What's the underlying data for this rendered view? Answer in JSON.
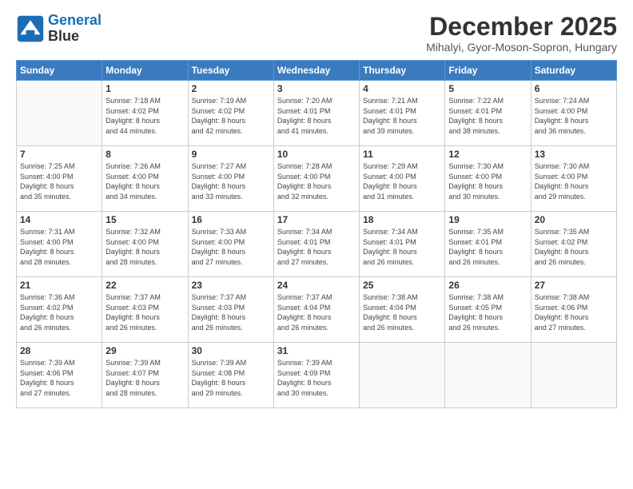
{
  "logo": {
    "line1": "General",
    "line2": "Blue"
  },
  "title": "December 2025",
  "location": "Mihalyi, Gyor-Moson-Sopron, Hungary",
  "days_of_week": [
    "Sunday",
    "Monday",
    "Tuesday",
    "Wednesday",
    "Thursday",
    "Friday",
    "Saturday"
  ],
  "weeks": [
    [
      {
        "day": "",
        "info": ""
      },
      {
        "day": "1",
        "info": "Sunrise: 7:18 AM\nSunset: 4:02 PM\nDaylight: 8 hours\nand 44 minutes."
      },
      {
        "day": "2",
        "info": "Sunrise: 7:19 AM\nSunset: 4:02 PM\nDaylight: 8 hours\nand 42 minutes."
      },
      {
        "day": "3",
        "info": "Sunrise: 7:20 AM\nSunset: 4:01 PM\nDaylight: 8 hours\nand 41 minutes."
      },
      {
        "day": "4",
        "info": "Sunrise: 7:21 AM\nSunset: 4:01 PM\nDaylight: 8 hours\nand 39 minutes."
      },
      {
        "day": "5",
        "info": "Sunrise: 7:22 AM\nSunset: 4:01 PM\nDaylight: 8 hours\nand 38 minutes."
      },
      {
        "day": "6",
        "info": "Sunrise: 7:24 AM\nSunset: 4:00 PM\nDaylight: 8 hours\nand 36 minutes."
      }
    ],
    [
      {
        "day": "7",
        "info": "Sunrise: 7:25 AM\nSunset: 4:00 PM\nDaylight: 8 hours\nand 35 minutes."
      },
      {
        "day": "8",
        "info": "Sunrise: 7:26 AM\nSunset: 4:00 PM\nDaylight: 8 hours\nand 34 minutes."
      },
      {
        "day": "9",
        "info": "Sunrise: 7:27 AM\nSunset: 4:00 PM\nDaylight: 8 hours\nand 33 minutes."
      },
      {
        "day": "10",
        "info": "Sunrise: 7:28 AM\nSunset: 4:00 PM\nDaylight: 8 hours\nand 32 minutes."
      },
      {
        "day": "11",
        "info": "Sunrise: 7:29 AM\nSunset: 4:00 PM\nDaylight: 8 hours\nand 31 minutes."
      },
      {
        "day": "12",
        "info": "Sunrise: 7:30 AM\nSunset: 4:00 PM\nDaylight: 8 hours\nand 30 minutes."
      },
      {
        "day": "13",
        "info": "Sunrise: 7:30 AM\nSunset: 4:00 PM\nDaylight: 8 hours\nand 29 minutes."
      }
    ],
    [
      {
        "day": "14",
        "info": "Sunrise: 7:31 AM\nSunset: 4:00 PM\nDaylight: 8 hours\nand 28 minutes."
      },
      {
        "day": "15",
        "info": "Sunrise: 7:32 AM\nSunset: 4:00 PM\nDaylight: 8 hours\nand 28 minutes."
      },
      {
        "day": "16",
        "info": "Sunrise: 7:33 AM\nSunset: 4:00 PM\nDaylight: 8 hours\nand 27 minutes."
      },
      {
        "day": "17",
        "info": "Sunrise: 7:34 AM\nSunset: 4:01 PM\nDaylight: 8 hours\nand 27 minutes."
      },
      {
        "day": "18",
        "info": "Sunrise: 7:34 AM\nSunset: 4:01 PM\nDaylight: 8 hours\nand 26 minutes."
      },
      {
        "day": "19",
        "info": "Sunrise: 7:35 AM\nSunset: 4:01 PM\nDaylight: 8 hours\nand 26 minutes."
      },
      {
        "day": "20",
        "info": "Sunrise: 7:35 AM\nSunset: 4:02 PM\nDaylight: 8 hours\nand 26 minutes."
      }
    ],
    [
      {
        "day": "21",
        "info": "Sunrise: 7:36 AM\nSunset: 4:02 PM\nDaylight: 8 hours\nand 26 minutes."
      },
      {
        "day": "22",
        "info": "Sunrise: 7:37 AM\nSunset: 4:03 PM\nDaylight: 8 hours\nand 26 minutes."
      },
      {
        "day": "23",
        "info": "Sunrise: 7:37 AM\nSunset: 4:03 PM\nDaylight: 8 hours\nand 26 minutes."
      },
      {
        "day": "24",
        "info": "Sunrise: 7:37 AM\nSunset: 4:04 PM\nDaylight: 8 hours\nand 26 minutes."
      },
      {
        "day": "25",
        "info": "Sunrise: 7:38 AM\nSunset: 4:04 PM\nDaylight: 8 hours\nand 26 minutes."
      },
      {
        "day": "26",
        "info": "Sunrise: 7:38 AM\nSunset: 4:05 PM\nDaylight: 8 hours\nand 26 minutes."
      },
      {
        "day": "27",
        "info": "Sunrise: 7:38 AM\nSunset: 4:06 PM\nDaylight: 8 hours\nand 27 minutes."
      }
    ],
    [
      {
        "day": "28",
        "info": "Sunrise: 7:39 AM\nSunset: 4:06 PM\nDaylight: 8 hours\nand 27 minutes."
      },
      {
        "day": "29",
        "info": "Sunrise: 7:39 AM\nSunset: 4:07 PM\nDaylight: 8 hours\nand 28 minutes."
      },
      {
        "day": "30",
        "info": "Sunrise: 7:39 AM\nSunset: 4:08 PM\nDaylight: 8 hours\nand 29 minutes."
      },
      {
        "day": "31",
        "info": "Sunrise: 7:39 AM\nSunset: 4:09 PM\nDaylight: 8 hours\nand 30 minutes."
      },
      {
        "day": "",
        "info": ""
      },
      {
        "day": "",
        "info": ""
      },
      {
        "day": "",
        "info": ""
      }
    ]
  ]
}
